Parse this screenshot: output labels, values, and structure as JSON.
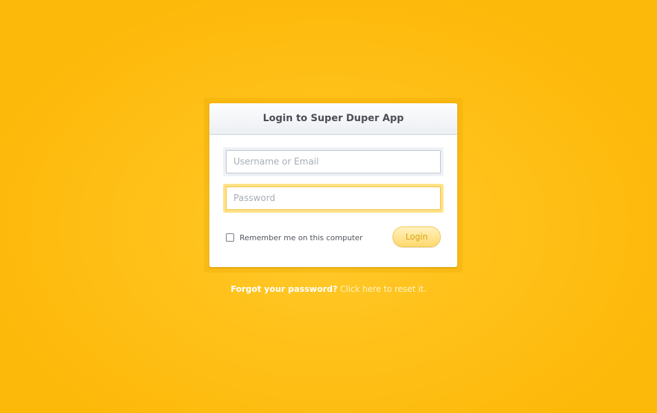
{
  "login_panel": {
    "title": "Login to Super Duper App",
    "username": {
      "placeholder": "Username or Email",
      "value": ""
    },
    "password": {
      "placeholder": "Password",
      "value": ""
    },
    "remember": {
      "label": "Remember me on this computer",
      "checked": false
    },
    "login_label": "Login"
  },
  "forgot": {
    "question": "Forgot your password?",
    "link": "Click here to reset it."
  },
  "colors": {
    "background": "#ffc11a",
    "accent": "#ffd96e",
    "focus_ring": "#ffe287"
  }
}
